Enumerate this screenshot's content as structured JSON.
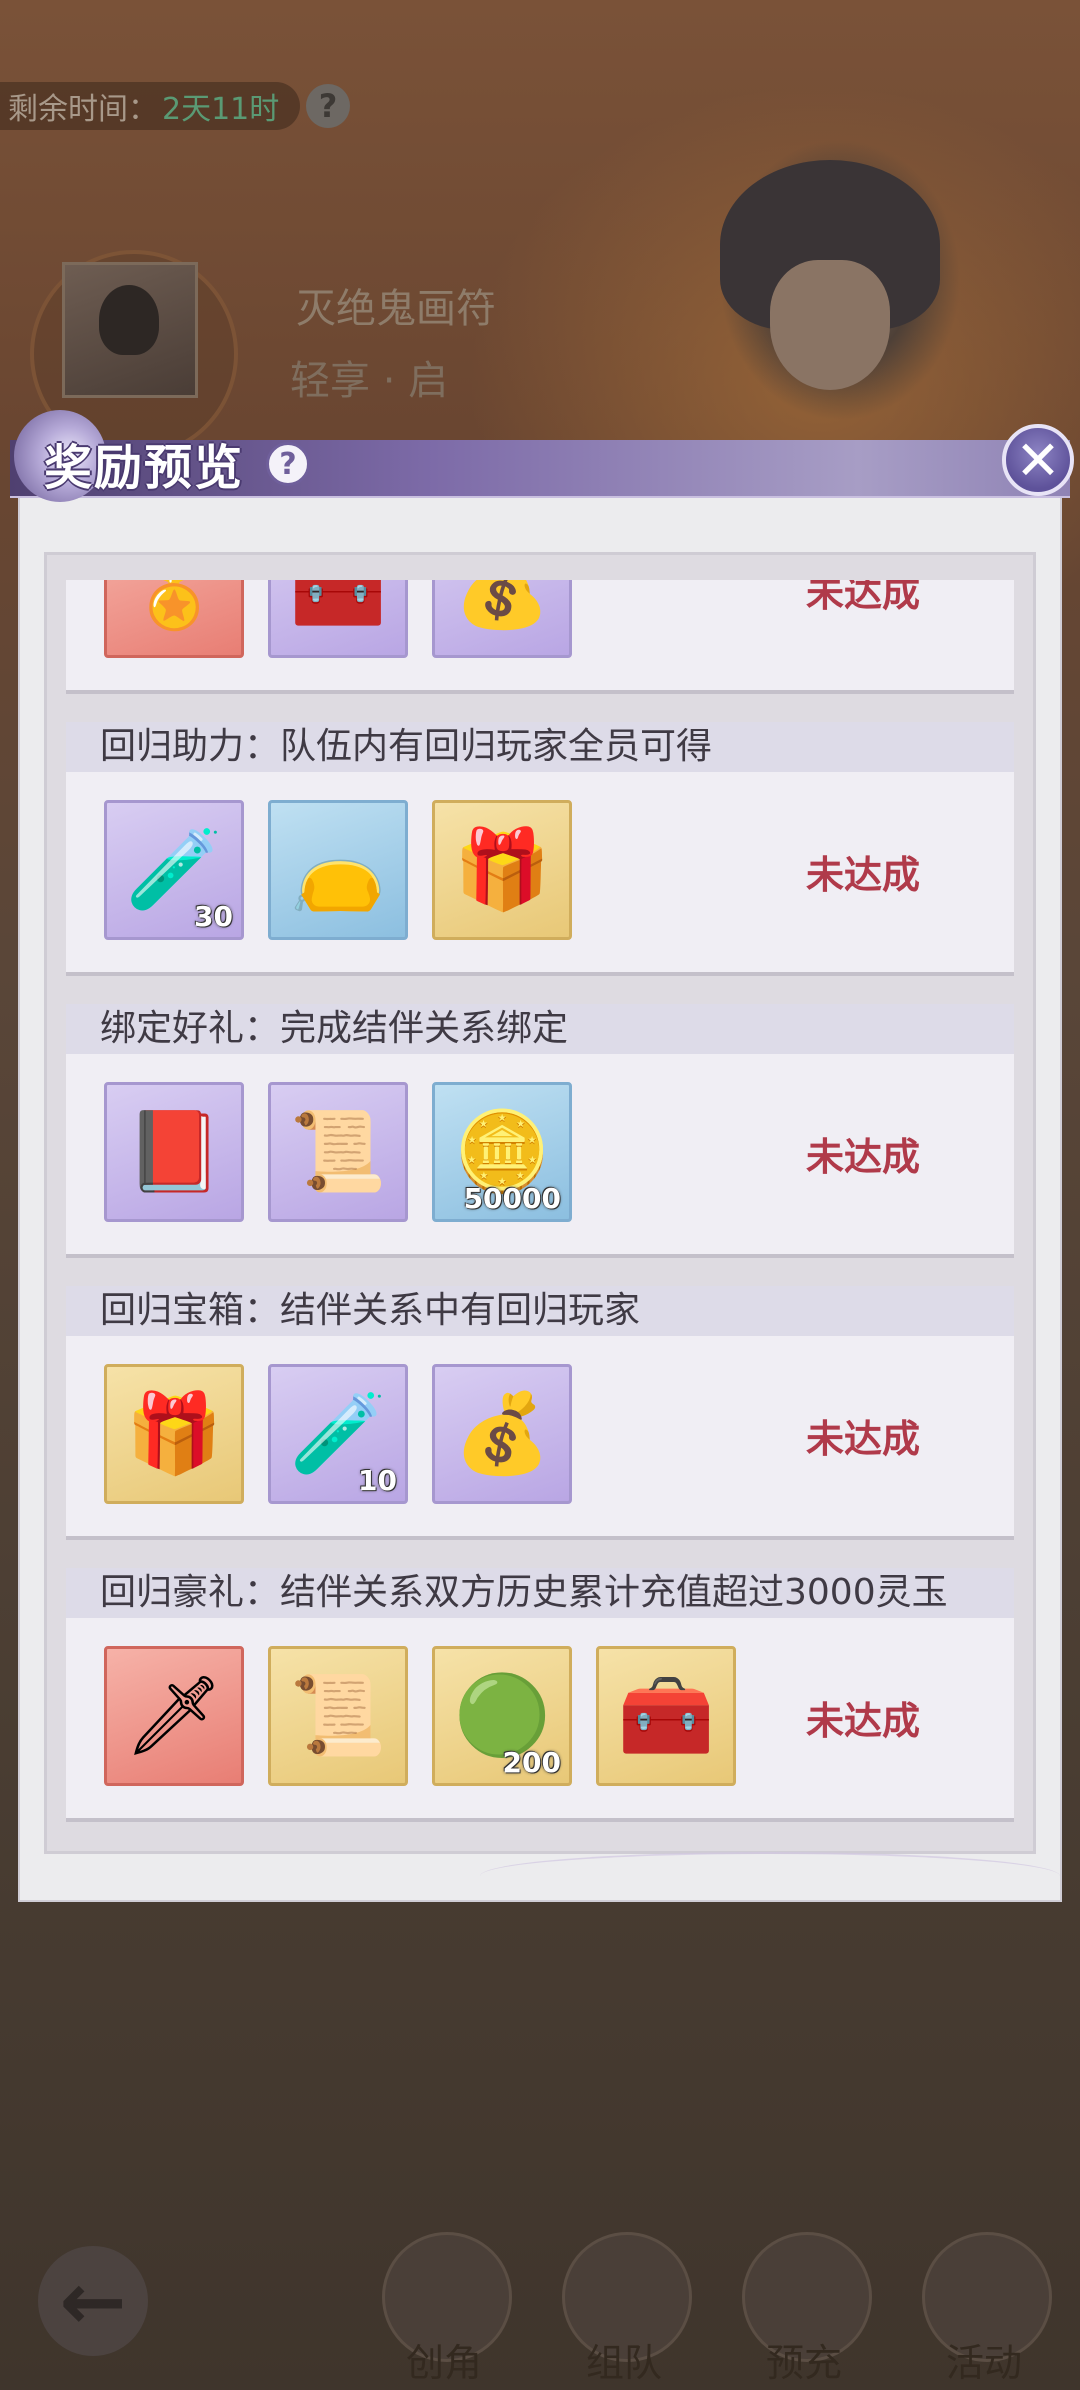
{
  "timer": {
    "label": "剩余时间：",
    "value": "2天11时",
    "help": "?"
  },
  "profile": {
    "name": "灭绝鬼画符",
    "subtitle": "轻享 · 启"
  },
  "modal": {
    "title": "奖励预览",
    "help": "?",
    "close": "✕",
    "rewards": [
      {
        "title": "",
        "status": "未达成",
        "items": [
          {
            "icon": "badge-icon",
            "glyph": "🏅",
            "frame": "red",
            "qty": ""
          },
          {
            "icon": "chest-icon",
            "glyph": "🧰",
            "frame": "purple",
            "qty": ""
          },
          {
            "icon": "gold-bag-icon",
            "glyph": "💰",
            "frame": "purple",
            "qty": ""
          }
        ]
      },
      {
        "title": "回归助力：队伍内有回归玩家全员可得",
        "status": "未达成",
        "items": [
          {
            "icon": "potion-icon",
            "glyph": "🧪",
            "frame": "purple",
            "qty": "30"
          },
          {
            "icon": "gem-bag-icon",
            "glyph": "👝",
            "frame": "blue",
            "qty": ""
          },
          {
            "icon": "gift-box-icon",
            "glyph": "🎁",
            "frame": "gold",
            "qty": ""
          }
        ]
      },
      {
        "title": "绑定好礼：完成结伴关系绑定",
        "status": "未达成",
        "items": [
          {
            "icon": "book-icon",
            "glyph": "📕",
            "frame": "purple",
            "qty": ""
          },
          {
            "icon": "scroll-icon",
            "glyph": "📜",
            "frame": "purple",
            "qty": ""
          },
          {
            "icon": "coin-icon",
            "glyph": "🪙",
            "frame": "blue",
            "qty": "50000"
          }
        ]
      },
      {
        "title": "回归宝箱：结伴关系中有回归玩家",
        "status": "未达成",
        "items": [
          {
            "icon": "gift-box-icon",
            "glyph": "🎁",
            "frame": "gold",
            "qty": ""
          },
          {
            "icon": "potion-icon",
            "glyph": "🧪",
            "frame": "purple",
            "qty": "10"
          },
          {
            "icon": "gold-bag-icon",
            "glyph": "💰",
            "frame": "purple",
            "qty": ""
          }
        ]
      },
      {
        "title": "回归豪礼：结伴关系双方历史累计充值超过3000灵玉",
        "status": "未达成",
        "items": [
          {
            "icon": "dagger-icon",
            "glyph": "🗡",
            "frame": "red",
            "qty": ""
          },
          {
            "icon": "red-scroll-icon",
            "glyph": "📜",
            "frame": "gold",
            "qty": ""
          },
          {
            "icon": "jade-icon",
            "glyph": "🟢",
            "frame": "gold",
            "qty": "200"
          },
          {
            "icon": "gold-chest-icon",
            "glyph": "🧰",
            "frame": "gold",
            "qty": ""
          }
        ]
      }
    ]
  },
  "nav": {
    "back": "←",
    "items": [
      {
        "label": "创角"
      },
      {
        "label": "组队"
      },
      {
        "label": "预充"
      },
      {
        "label": "活动"
      }
    ]
  }
}
